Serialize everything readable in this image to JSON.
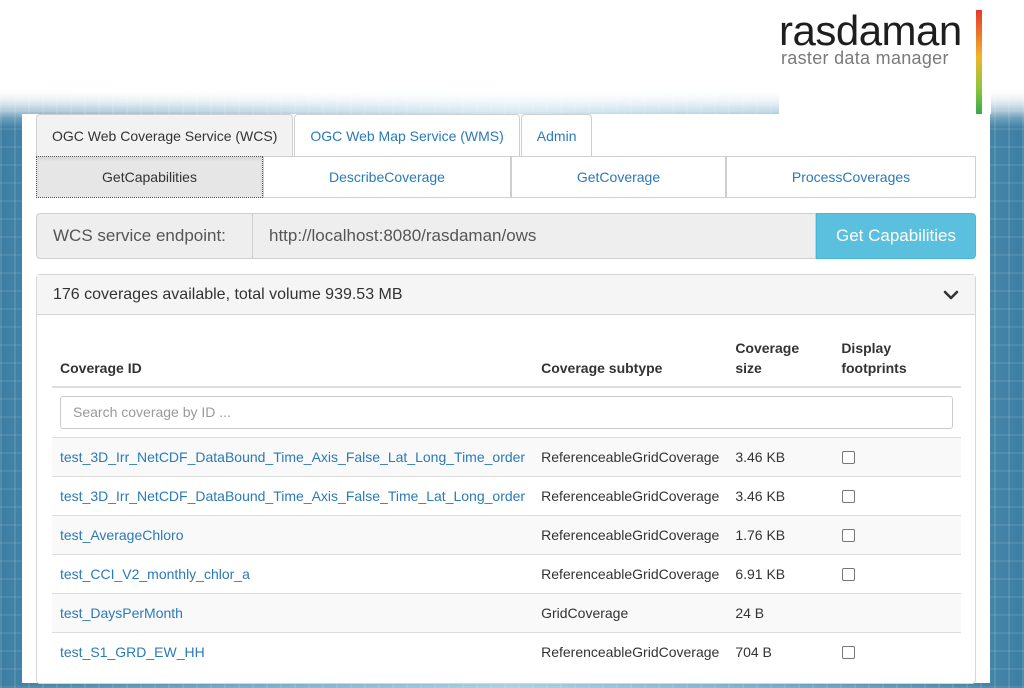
{
  "logo": {
    "word": "rasdaman",
    "tagline": "raster data manager"
  },
  "tabs": [
    {
      "label": "OGC Web Coverage Service (WCS)",
      "active": true
    },
    {
      "label": "OGC Web Map Service (WMS)",
      "active": false
    },
    {
      "label": "Admin",
      "active": false
    }
  ],
  "subtabs": [
    {
      "label": "GetCapabilities",
      "active": true
    },
    {
      "label": "DescribeCoverage",
      "active": false
    },
    {
      "label": "GetCoverage",
      "active": false
    },
    {
      "label": "ProcessCoverages",
      "active": false
    }
  ],
  "endpoint": {
    "label": "WCS service endpoint:",
    "value": "http://localhost:8080/rasdaman/ows",
    "button": "Get Capabilities"
  },
  "summary": {
    "text": "176 coverages available, total volume 939.53 MB",
    "icon": "chevron-down-icon"
  },
  "table": {
    "headers": {
      "id": "Coverage ID",
      "subtype": "Coverage subtype",
      "size_1": "Coverage",
      "size_2": "size",
      "foot_1": "Display",
      "foot_2": "footprints"
    },
    "search_placeholder": "Search coverage by ID ...",
    "rows": [
      {
        "id": "test_3D_Irr_NetCDF_DataBound_Time_Axis_False_Lat_Long_Time_order",
        "subtype": "ReferenceableGridCoverage",
        "size": "3.46 KB",
        "footprint": true
      },
      {
        "id": "test_3D_Irr_NetCDF_DataBound_Time_Axis_False_Time_Lat_Long_order",
        "subtype": "ReferenceableGridCoverage",
        "size": "3.46 KB",
        "footprint": true
      },
      {
        "id": "test_AverageChloro",
        "subtype": "ReferenceableGridCoverage",
        "size": "1.76 KB",
        "footprint": true
      },
      {
        "id": "test_CCI_V2_monthly_chlor_a",
        "subtype": "ReferenceableGridCoverage",
        "size": "6.91 KB",
        "footprint": true
      },
      {
        "id": "test_DaysPerMonth",
        "subtype": "GridCoverage",
        "size": "24 B",
        "footprint": false
      },
      {
        "id": "test_S1_GRD_EW_HH",
        "subtype": "ReferenceableGridCoverage",
        "size": "704 B",
        "footprint": true
      }
    ]
  },
  "colors": {
    "link": "#2a7ab8",
    "button": "#5bc0de"
  }
}
